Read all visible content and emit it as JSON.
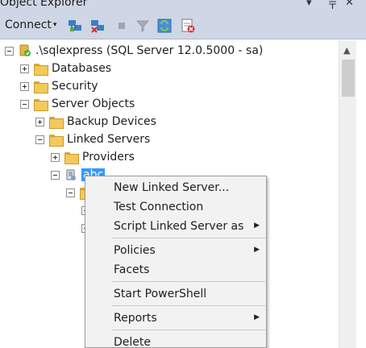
{
  "panel": {
    "title": "Object Explorer",
    "pin_glyph": "▾ 〒",
    "close_glyph": "✕"
  },
  "toolbar": {
    "connect_label": "Connect",
    "connect_arrow": "▾",
    "icons": [
      "connect-object-explorer-icon",
      "disconnect-icon",
      "stop-icon",
      "filter-icon",
      "refresh-icon",
      "activity-monitor-icon"
    ]
  },
  "tree": {
    "server": ".\\sqlexpress (SQL Server 12.0.5000 - sa)",
    "databases": "Databases",
    "security": "Security",
    "server_objects": "Server Objects",
    "backup_devices": "Backup Devices",
    "linked_servers": "Linked Servers",
    "providers": "Providers",
    "linked_server_item": "abc"
  },
  "context_menu": {
    "items": [
      {
        "label": "New Linked Server..."
      },
      {
        "label": "Test Connection"
      },
      {
        "label": "Script Linked Server as",
        "submenu": true
      },
      {
        "label": "Policies",
        "submenu": true
      },
      {
        "label": "Facets"
      },
      {
        "label": "Start PowerShell"
      },
      {
        "label": "Reports",
        "submenu": true
      },
      {
        "label": "Delete"
      }
    ],
    "submenu_glyph": "▶"
  },
  "scrollbar": {
    "up_glyph": "▲"
  },
  "colors": {
    "toolbar_bg": "#cfd6e5",
    "selection": "#3399ff",
    "menu_bg": "#f2f2f2"
  }
}
